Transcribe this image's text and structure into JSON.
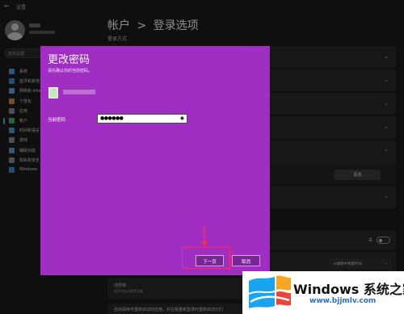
{
  "window": {
    "back_icon": "back-arrow-icon",
    "title": "设置"
  },
  "sidebar": {
    "search_placeholder": "查找设置",
    "items": [
      {
        "label": "系统",
        "color": "#4d9be6",
        "icon": "system-icon"
      },
      {
        "label": "蓝牙和其他",
        "color": "#3a8ee0",
        "icon": "bluetooth-icon"
      },
      {
        "label": "网络和 Inte",
        "color": "#5fa3e8",
        "icon": "network-icon"
      },
      {
        "label": "个性化",
        "color": "#d98c4a",
        "icon": "personalization-icon"
      },
      {
        "label": "应用",
        "color": "#8e8ea0",
        "icon": "apps-icon"
      },
      {
        "label": "帐户",
        "color": "#45b86c",
        "icon": "account-icon"
      },
      {
        "label": "时间和语言",
        "color": "#4d9be6",
        "icon": "time-language-icon"
      },
      {
        "label": "游戏",
        "color": "#8e8ea0",
        "icon": "gaming-icon"
      },
      {
        "label": "辅助功能",
        "color": "#5fa3e8",
        "icon": "accessibility-icon"
      },
      {
        "label": "隐私和安全",
        "color": "#8e8ea0",
        "icon": "privacy-icon"
      },
      {
        "label": "Windows",
        "color": "#3a8ee0",
        "icon": "windows-update-icon"
      }
    ],
    "active_index": 5
  },
  "main": {
    "breadcrumb_parent": "帐户",
    "breadcrumb_sep": ">",
    "breadcrumb_current": "登录选项",
    "section_title": "登录方式",
    "change_button": "更改",
    "dynamic_lock_title": "动态锁",
    "dynamic_lock_sub": "离开时自动锁定设备",
    "restart_apps_text": "自动保存可重新启动的应用，并在我重新登录时重新启动它们",
    "toggle_text": "关",
    "dropdown_value": "从睡眠中唤醒时间"
  },
  "dialog": {
    "title": "更改密码",
    "subtitle": "请先确认你的当前密码。",
    "password_label": "当前密码",
    "password_value": "●●●●●●",
    "eye_icon": "show-password-icon",
    "next_button": "下一页",
    "cancel_button": "取消"
  },
  "annotation": {
    "color": "#ff2c55"
  },
  "watermark": {
    "brand": "Windows 系统之家",
    "url": "www.bjjmlv.com"
  }
}
